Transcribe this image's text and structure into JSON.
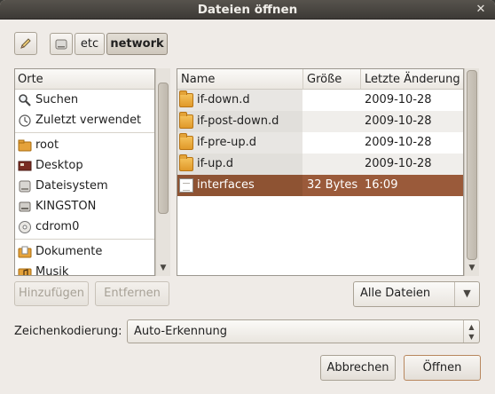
{
  "window": {
    "title": "Dateien öffnen",
    "close_glyph": "✕"
  },
  "pathbar": {
    "edit_icon": "pencil-icon",
    "crumbs": [
      "etc",
      "network"
    ],
    "drive_icon": "drive-icon"
  },
  "places": {
    "header": "Orte",
    "items": [
      {
        "label": "Suchen",
        "icon": "search-icon"
      },
      {
        "label": "Zuletzt verwendet",
        "icon": "recent-icon"
      },
      {
        "label": "root",
        "icon": "home-folder-icon"
      },
      {
        "label": "Desktop",
        "icon": "desktop-icon"
      },
      {
        "label": "Dateisystem",
        "icon": "filesystem-icon"
      },
      {
        "label": "KINGSTON",
        "icon": "usb-drive-icon"
      },
      {
        "label": "cdrom0",
        "icon": "cdrom-icon"
      },
      {
        "label": "Dokumente",
        "icon": "documents-folder-icon"
      },
      {
        "label": "Musik",
        "icon": "music-folder-icon"
      }
    ]
  },
  "files": {
    "columns": [
      "Name",
      "Größe",
      "Letzte Änderung"
    ],
    "rows": [
      {
        "name": "if-down.d",
        "size": "",
        "date": "2009-10-28",
        "type": "folder"
      },
      {
        "name": "if-post-down.d",
        "size": "",
        "date": "2009-10-28",
        "type": "folder"
      },
      {
        "name": "if-pre-up.d",
        "size": "",
        "date": "2009-10-28",
        "type": "folder"
      },
      {
        "name": "if-up.d",
        "size": "",
        "date": "2009-10-28",
        "type": "folder"
      },
      {
        "name": "interfaces",
        "size": "32 Bytes",
        "date": "16:09",
        "type": "file",
        "selected": true
      }
    ]
  },
  "buttons": {
    "add": "Hinzufügen",
    "remove": "Entfernen",
    "cancel": "Abbrechen",
    "open": "Öffnen"
  },
  "filter": {
    "value": "Alle Dateien"
  },
  "encoding": {
    "label": "Zeichenkodierung:",
    "value": "Auto-Erkennung"
  },
  "colors": {
    "selection": "#9a5a3a",
    "titlebar": "#3d3a36",
    "background": "#efebe7"
  }
}
